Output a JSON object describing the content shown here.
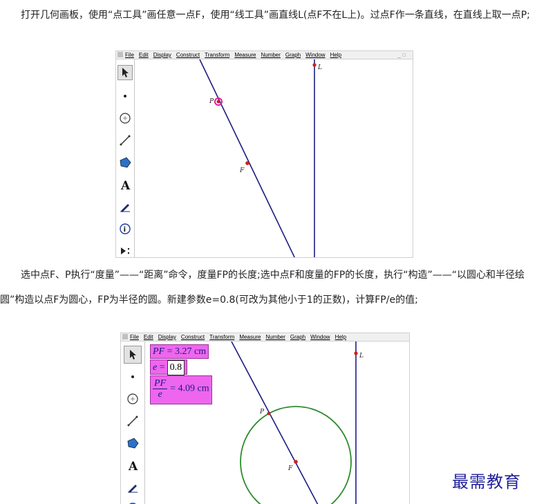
{
  "paragraphs": {
    "p1": "打开几何画板，使用“点工具”画任意一点F，使用“线工具”画直线L(点F不在L上)。过点F作一条直线，在直线上取一点P;",
    "p2": "选中点F、P执行“度量”——“距离”命令，度量FP的长度;选中点F和度量的FP的长度，执行“构造”——“以圆心和半径绘圆”构造以点F为圆心，FP为半径的圆。新建参数e=0.8(可改为其他小于1的正数)，计算FP/e的值;"
  },
  "menu": {
    "items": [
      "File",
      "Edit",
      "Display",
      "Construct",
      "Transform",
      "Measure",
      "Number",
      "Graph",
      "Window",
      "Help"
    ],
    "window_controls": "_ □"
  },
  "tools": [
    {
      "name": "arrow-tool-icon",
      "icon": "arrow"
    },
    {
      "name": "point-tool-icon",
      "icon": "point"
    },
    {
      "name": "compass-tool-icon",
      "icon": "compass"
    },
    {
      "name": "straightedge-tool-icon",
      "icon": "straightedge"
    },
    {
      "name": "polygon-tool-icon",
      "icon": "polygon"
    },
    {
      "name": "text-tool-icon",
      "icon": "A"
    },
    {
      "name": "marker-tool-icon",
      "icon": "marker"
    },
    {
      "name": "info-tool-icon",
      "icon": "info"
    },
    {
      "name": "custom-tool-icon",
      "icon": "custom"
    }
  ],
  "labels": {
    "P": "P",
    "F": "F",
    "L": "L"
  },
  "measurements": {
    "pf_symbol": "PF",
    "pf_value": "= 3.27 cm",
    "e_symbol": "e",
    "e_eq": "=",
    "e_value": "0.8",
    "frac_num": "PF",
    "frac_den": "e",
    "frac_value": "= 4.09 cm"
  },
  "colors": {
    "line": "#1c1c80",
    "point": "#cc2020",
    "circle": "#2e8b2e",
    "measure_bg": "#ee66ee",
    "watermark": "#22229a"
  },
  "watermark": "最需教育"
}
